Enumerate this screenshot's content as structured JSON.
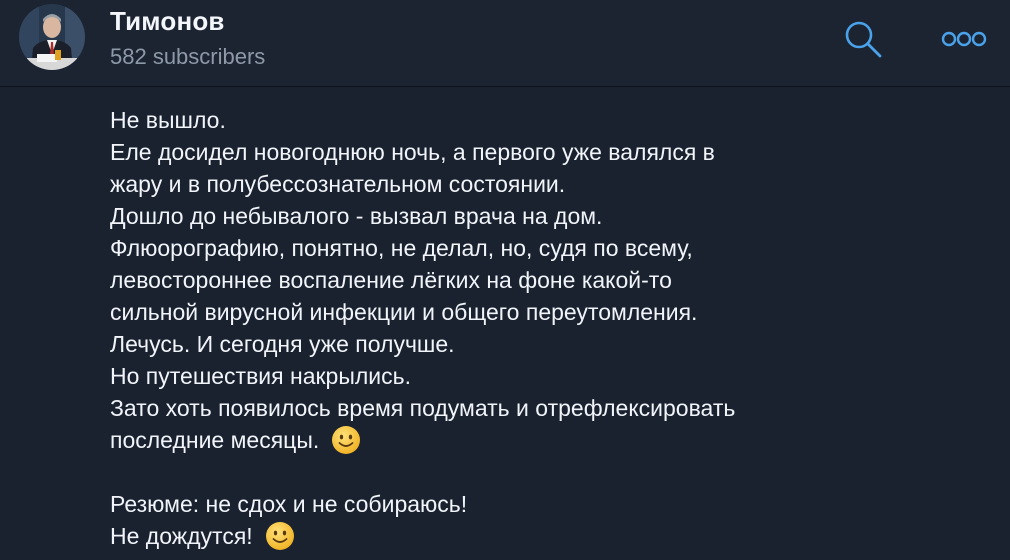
{
  "header": {
    "title": "Тимонов",
    "subtitle": "582 subscribers",
    "icons": {
      "avatar": "channel-avatar",
      "search": "search-icon",
      "more": "more-options-icon"
    },
    "colors": {
      "accent": "#4aa3ea",
      "background": "#1a2230",
      "header_background": "#1c2432",
      "subtitle": "#8e99a8",
      "text": "#f1f4f8"
    }
  },
  "message": {
    "lines": [
      "Не вышло.",
      "Еле досидел новогоднюю ночь, а первого уже валялся в",
      "жару и в полубессознательном состоянии.",
      "Дошло до небывалого - вызвал врача на дом.",
      "Флюорографию, понятно, не делал, но, судя по всему,",
      "левостороннее воспаление лёгких на фоне какой-то",
      "сильной вирусной инфекции и общего переутомления.",
      "Лечусь. И сегодня уже получше.",
      "Но путешествия накрылись.",
      "Зато хоть появилось время подумать и отрефлексировать",
      "последние месяцы.",
      "",
      "Резюме: не сдох и не собираюсь!",
      "Не дождутся!"
    ],
    "emoji": "slightly-smiling-face-emoji"
  }
}
